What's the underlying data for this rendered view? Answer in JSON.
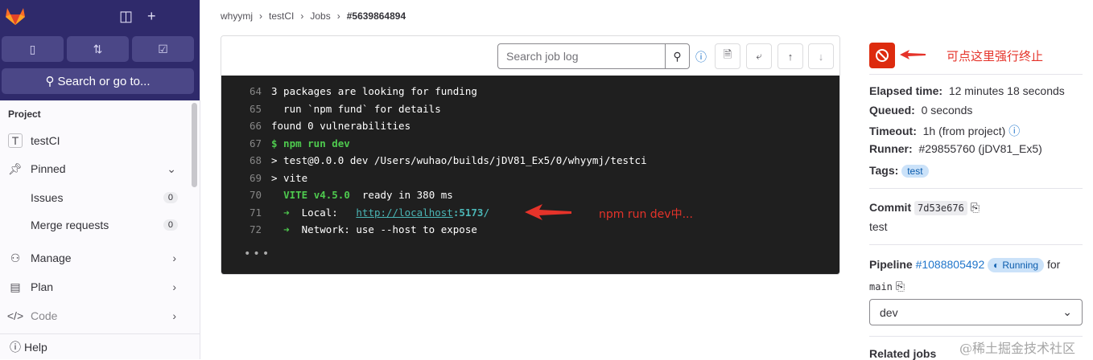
{
  "sidebar": {
    "search_label": "Search or go to...",
    "section": "Project",
    "project": {
      "avatar": "T",
      "name": "testCI"
    },
    "items": [
      {
        "label": "Pinned"
      },
      {
        "label": "Issues",
        "count": "0"
      },
      {
        "label": "Merge requests",
        "count": "0"
      },
      {
        "label": "Manage"
      },
      {
        "label": "Plan"
      },
      {
        "label": "Code"
      }
    ],
    "help": "Help"
  },
  "breadcrumb": [
    "whyymj",
    "testCI",
    "Jobs",
    "#5639864894"
  ],
  "log": {
    "search_placeholder": "Search job log",
    "lines": [
      {
        "n": "64",
        "parts": [
          {
            "t": "3 packages are looking for funding"
          }
        ]
      },
      {
        "n": "65",
        "parts": [
          {
            "t": "  run `npm fund` for details"
          }
        ]
      },
      {
        "n": "66",
        "parts": [
          {
            "t": "found 0 vulnerabilities"
          }
        ]
      },
      {
        "n": "67",
        "parts": [
          {
            "t": "$ npm run dev",
            "c": "g"
          }
        ]
      },
      {
        "n": "68",
        "parts": [
          {
            "t": "> test@0.0.0 dev /Users/wuhao/builds/jDV81_Ex5/0/whyymj/testci"
          }
        ]
      },
      {
        "n": "69",
        "parts": [
          {
            "t": "> vite"
          }
        ]
      },
      {
        "n": "70",
        "parts": [
          {
            "t": "  "
          },
          {
            "t": "VITE v4.5.0",
            "c": "g"
          },
          {
            "t": "  ready in 380 ms"
          }
        ]
      },
      {
        "n": "71",
        "parts": [
          {
            "t": "  "
          },
          {
            "t": "➜",
            "c": "g"
          },
          {
            "t": "  Local:   "
          },
          {
            "t": "http://localhost",
            "c": "link"
          },
          {
            "t": ":5173/",
            "c": "g2"
          }
        ]
      },
      {
        "n": "72",
        "parts": [
          {
            "t": "  "
          },
          {
            "t": "➜",
            "c": "g"
          },
          {
            "t": "  Network: use --host to expose"
          }
        ]
      }
    ],
    "annotation": "npm  run dev中..."
  },
  "job": {
    "cancel_annotation": "可点这里强行终止",
    "elapsed_label": "Elapsed time:",
    "elapsed": "12 minutes 18 seconds",
    "queued_label": "Queued:",
    "queued": "0 seconds",
    "timeout_label": "Timeout:",
    "timeout": "1h (from project)",
    "runner_label": "Runner:",
    "runner": "#29855760 (jDV81_Ex5)",
    "tags_label": "Tags:",
    "tag": "test",
    "commit_label": "Commit",
    "commit": "7d53e676",
    "commit_msg": "test",
    "pipeline_label": "Pipeline",
    "pipeline": "#1088805492",
    "status": "Running",
    "for": "for",
    "branch": "main",
    "stage": "dev",
    "related": "Related jobs"
  },
  "watermark": "@稀土掘金技术社区"
}
